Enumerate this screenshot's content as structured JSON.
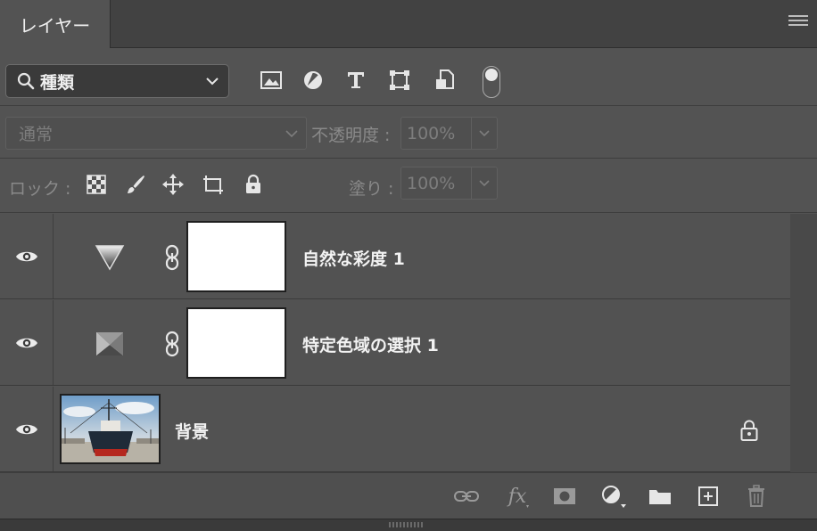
{
  "panel": {
    "tab_label": "レイヤー",
    "menu_icon": "hamburger-menu-icon"
  },
  "filter": {
    "kind_label": "種類",
    "icons": [
      "image-filter-icon",
      "adjustment-filter-icon",
      "type-filter-icon",
      "shape-filter-icon",
      "smart-object-filter-icon"
    ],
    "toggle_on": true
  },
  "blend": {
    "mode": "通常",
    "opacity_label": "不透明度 :",
    "opacity_value": "100%"
  },
  "lock": {
    "label": "ロック :",
    "icons": [
      "lock-transparent-pixels-icon",
      "lock-image-pixels-icon",
      "lock-position-icon",
      "lock-artboard-icon",
      "lock-all-icon"
    ],
    "fill_label": "塗り :",
    "fill_value": "100%"
  },
  "layers": [
    {
      "name": "自然な彩度 1",
      "type": "adjustment",
      "icon": "vibrance-icon",
      "visible": true
    },
    {
      "name": "特定色域の選択 1",
      "type": "adjustment",
      "icon": "selective-color-icon",
      "visible": true
    },
    {
      "name": "背景",
      "type": "background",
      "icon": "ship-photo",
      "visible": true,
      "locked": true
    }
  ],
  "toolbar": {
    "fx_label": "fx",
    "icons": [
      "link-layers-icon",
      "fx-icon",
      "add-mask-icon",
      "new-adjustment-icon",
      "new-group-icon",
      "new-layer-icon",
      "delete-icon"
    ]
  },
  "colors": {
    "panel_bg": "#535353",
    "tab_bar_bg": "#424242",
    "text": "#f0f0f0",
    "disabled_text": "#7d7d7d"
  }
}
